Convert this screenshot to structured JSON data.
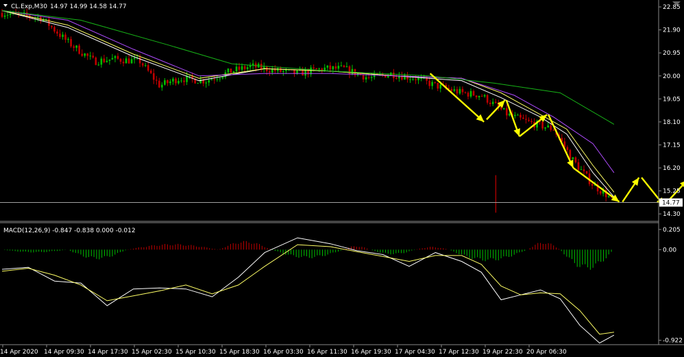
{
  "header": {
    "symbol_label": "CL.Exp,M30",
    "ohlc": "14.97 14.99 14.58 14.77"
  },
  "macd": {
    "label": "MACD(12,26,9) -0.847 -0.838 0.000 -0.012"
  },
  "colors": {
    "background": "#000000",
    "bull_candle": "#00c000",
    "bear_candle": "#c00000",
    "ma_fast": "#ffffff",
    "ma_mid": "#ffff66",
    "ma_slow": "#b04cff",
    "ma_long": "#17b317",
    "arrow": "#ffff00",
    "price_line": "#a0a0a0"
  },
  "chart_data": [
    {
      "type": "candlestick",
      "symbol": "CL.Exp",
      "timeframe": "M30",
      "y_ticks": [
        "22.85",
        "21.90",
        "20.95",
        "20.00",
        "19.05",
        "18.10",
        "17.15",
        "16.20",
        "15.25",
        "14.30"
      ],
      "ylim": [
        14.05,
        23.05
      ],
      "current_price": "14.77",
      "x_ticks": [
        "14 Apr 2020",
        "14 Apr 09:30",
        "14 Apr 17:30",
        "15 Apr 02:30",
        "15 Apr 10:30",
        "15 Apr 18:30",
        "16 Apr 03:30",
        "16 Apr 11:30",
        "16 Apr 19:30",
        "17 Apr 04:30",
        "17 Apr 12:30",
        "19 Apr 22:30",
        "20 Apr 06:30"
      ],
      "close_path": [
        [
          0,
          22.6
        ],
        [
          6,
          22.4
        ],
        [
          10,
          21.4
        ],
        [
          14,
          20.6
        ],
        [
          17,
          20.7
        ],
        [
          21,
          20.6
        ],
        [
          24,
          19.6
        ],
        [
          27,
          19.9
        ],
        [
          31,
          19.8
        ],
        [
          35,
          20.2
        ],
        [
          38,
          20.4
        ],
        [
          42,
          20.2
        ],
        [
          45,
          20.1
        ],
        [
          49,
          20.3
        ],
        [
          52,
          20.3
        ],
        [
          56,
          19.9
        ],
        [
          59,
          20.1
        ],
        [
          63,
          19.9
        ],
        [
          66,
          19.6
        ],
        [
          70,
          19.3
        ],
        [
          73,
          19.2
        ],
        [
          77,
          18.4
        ],
        [
          80,
          18.1
        ],
        [
          84,
          17.8
        ],
        [
          87,
          16.5
        ],
        [
          90,
          15.5
        ],
        [
          92,
          15.1
        ],
        [
          93.2,
          14.77
        ]
      ],
      "moving_averages": [
        {
          "role": "fast",
          "points": [
            [
              0,
              22.7
            ],
            [
              10,
              22.0
            ],
            [
              20,
              20.8
            ],
            [
              30,
              19.8
            ],
            [
              40,
              20.3
            ],
            [
              50,
              20.2
            ],
            [
              60,
              20.0
            ],
            [
              70,
              19.8
            ],
            [
              76,
              19.1
            ],
            [
              82,
              18.3
            ],
            [
              86,
              17.6
            ],
            [
              90,
              16.0
            ],
            [
              93.2,
              15.0
            ]
          ]
        },
        {
          "role": "mid",
          "points": [
            [
              0,
              22.7
            ],
            [
              10,
              22.1
            ],
            [
              20,
              20.9
            ],
            [
              30,
              19.9
            ],
            [
              40,
              20.3
            ],
            [
              50,
              20.2
            ],
            [
              60,
              20.0
            ],
            [
              70,
              19.9
            ],
            [
              76,
              19.3
            ],
            [
              82,
              18.4
            ],
            [
              86,
              17.8
            ],
            [
              90,
              16.3
            ],
            [
              93.2,
              15.2
            ]
          ]
        },
        {
          "role": "slow",
          "points": [
            [
              0,
              22.7
            ],
            [
              10,
              22.3
            ],
            [
              20,
              21.1
            ],
            [
              30,
              20.0
            ],
            [
              40,
              20.1
            ],
            [
              50,
              20.1
            ],
            [
              60,
              20.0
            ],
            [
              70,
              19.9
            ],
            [
              78,
              19.2
            ],
            [
              84,
              18.3
            ],
            [
              90,
              17.2
            ],
            [
              93.2,
              16.0
            ]
          ]
        },
        {
          "role": "long",
          "points": [
            [
              0,
              22.7
            ],
            [
              12,
              22.3
            ],
            [
              25,
              21.3
            ],
            [
              35,
              20.5
            ],
            [
              50,
              20.2
            ],
            [
              65,
              20.0
            ],
            [
              75,
              19.7
            ],
            [
              85,
              19.3
            ],
            [
              93.2,
              18.0
            ]
          ]
        }
      ],
      "forecast_arrows": [
        {
          "from": [
            65.2,
            20.1
          ],
          "to": [
            73.4,
            18.1
          ]
        },
        {
          "from": [
            73.8,
            18.2
          ],
          "to": [
            76.6,
            19.0
          ]
        },
        {
          "from": [
            76.8,
            19.0
          ],
          "to": [
            78.8,
            17.5
          ]
        },
        {
          "from": [
            78.8,
            17.5
          ],
          "to": [
            83.0,
            18.4
          ]
        },
        {
          "from": [
            83.2,
            18.4
          ],
          "to": [
            87.0,
            16.2
          ]
        },
        {
          "from": [
            87.0,
            16.2
          ],
          "to": [
            94.0,
            14.8
          ]
        },
        {
          "from": [
            94.5,
            14.8
          ],
          "to": [
            97.0,
            15.8
          ]
        },
        {
          "from": [
            97.4,
            15.8
          ],
          "to": [
            100.8,
            14.65
          ]
        },
        {
          "from": [
            100.8,
            14.65
          ],
          "to": [
            104.4,
            15.7
          ]
        },
        {
          "from": [
            104.5,
            15.7
          ],
          "to": [
            111.8,
            13.9
          ]
        }
      ]
    },
    {
      "type": "line",
      "indicator": "MACD(12,26,9)",
      "y_ticks": [
        "0.205",
        "0.00",
        "-0.922"
      ],
      "ylim": [
        -0.96,
        0.26
      ],
      "series": [
        {
          "role": "macd-main",
          "points": [
            [
              0,
              -0.2
            ],
            [
              4,
              -0.18
            ],
            [
              8,
              -0.32
            ],
            [
              12,
              -0.34
            ],
            [
              16,
              -0.57
            ],
            [
              20,
              -0.4
            ],
            [
              24,
              -0.39
            ],
            [
              28,
              -0.4
            ],
            [
              32,
              -0.48
            ],
            [
              36,
              -0.28
            ],
            [
              40,
              -0.03
            ],
            [
              45,
              0.12
            ],
            [
              50,
              0.06
            ],
            [
              54,
              -0.01
            ],
            [
              58,
              -0.05
            ],
            [
              62,
              -0.17
            ],
            [
              66,
              -0.03
            ],
            [
              70,
              -0.12
            ],
            [
              73,
              -0.23
            ],
            [
              76,
              -0.51
            ],
            [
              79,
              -0.46
            ],
            [
              82,
              -0.41
            ],
            [
              85,
              -0.5
            ],
            [
              88,
              -0.77
            ],
            [
              91,
              -0.95
            ],
            [
              93.2,
              -0.87
            ]
          ]
        },
        {
          "role": "signal",
          "points": [
            [
              0,
              -0.22
            ],
            [
              4,
              -0.19
            ],
            [
              8,
              -0.26
            ],
            [
              12,
              -0.36
            ],
            [
              16,
              -0.52
            ],
            [
              20,
              -0.47
            ],
            [
              24,
              -0.42
            ],
            [
              28,
              -0.36
            ],
            [
              32,
              -0.45
            ],
            [
              36,
              -0.36
            ],
            [
              40,
              -0.17
            ],
            [
              45,
              0.05
            ],
            [
              50,
              0.03
            ],
            [
              54,
              -0.02
            ],
            [
              58,
              -0.07
            ],
            [
              62,
              -0.12
            ],
            [
              66,
              -0.06
            ],
            [
              70,
              -0.06
            ],
            [
              73,
              -0.15
            ],
            [
              76,
              -0.37
            ],
            [
              79,
              -0.46
            ],
            [
              82,
              -0.44
            ],
            [
              85,
              -0.45
            ],
            [
              88,
              -0.62
            ],
            [
              91,
              -0.86
            ],
            [
              93.2,
              -0.84
            ]
          ]
        }
      ],
      "histogram": [
        {
          "from": 0,
          "to": 10,
          "peak": -0.03
        },
        {
          "from": 10,
          "to": 19,
          "peak": -0.1
        },
        {
          "from": 19,
          "to": 33,
          "peak": 0.06
        },
        {
          "from": 33,
          "to": 41,
          "peak": 0.09
        },
        {
          "from": 41,
          "to": 52,
          "peak": -0.09
        },
        {
          "from": 52,
          "to": 56,
          "peak": 0.04
        },
        {
          "from": 56,
          "to": 63,
          "peak": -0.05
        },
        {
          "from": 63,
          "to": 68,
          "peak": 0.03
        },
        {
          "from": 68,
          "to": 80,
          "peak": -0.12
        },
        {
          "from": 80,
          "to": 85,
          "peak": 0.08
        },
        {
          "from": 85,
          "to": 93.2,
          "peak": -0.21
        }
      ]
    }
  ]
}
